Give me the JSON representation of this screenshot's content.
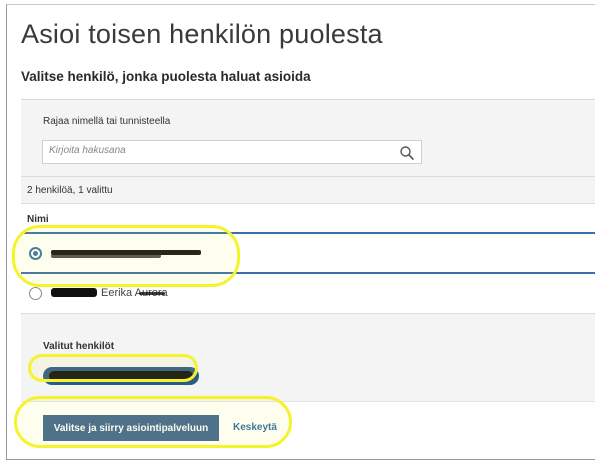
{
  "page": {
    "title": "Asioi toisen henkilön puolesta",
    "subtitle": "Valitse henkilö, jonka puolesta haluat asioida"
  },
  "filter": {
    "label": "Rajaa nimellä tai tunnisteella",
    "placeholder": "Kirjoita hakusana",
    "value": ""
  },
  "results": {
    "count_text": "2 henkilöä, 1 valittu",
    "column_header": "Nimi",
    "rows": [
      {
        "name": "",
        "selected": true,
        "redacted": true
      },
      {
        "name": "Eerika Aurora",
        "selected": false,
        "redacted": false
      }
    ]
  },
  "selected_people": {
    "label": "Valitut henkilöt",
    "chip_redacted": true
  },
  "actions": {
    "primary_label": "Valitse ja siirry asiointipalveluun",
    "cancel_label": "Keskeytä"
  },
  "colors": {
    "accent": "#3a6ea5",
    "primary_button": "#3d6490",
    "link": "#2f6aa0",
    "highlight": "#f4f32c"
  }
}
